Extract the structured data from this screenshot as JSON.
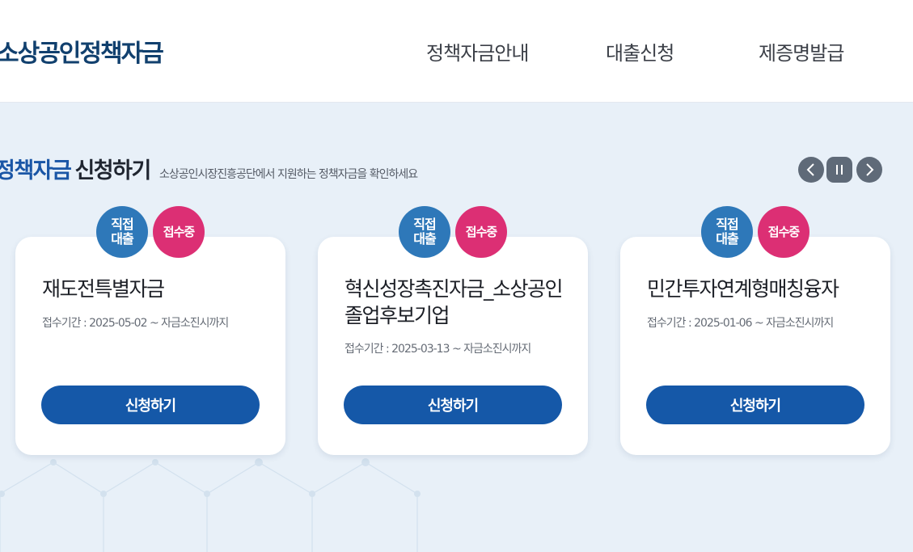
{
  "header": {
    "logo": "소상공인정책자금",
    "nav": [
      "정책자금안내",
      "대출신청",
      "제증명발급"
    ]
  },
  "section": {
    "title_accent": "정책자금",
    "title_main": "신청하기",
    "subtitle": "소상공인시장진흥공단에서 지원하는 정책자금을 확인하세요"
  },
  "slider_controls": [
    "prev-icon",
    "pause-icon",
    "next-icon"
  ],
  "cards": [
    {
      "badge_type": "직접\n대출",
      "badge_status": "접수중",
      "title": "재도전특별자금",
      "period": "접수기간 : 2025-05-02 ~ 자금소진시까지",
      "button": "신청하기"
    },
    {
      "badge_type": "직접\n대출",
      "badge_status": "접수중",
      "title": "혁신성장촉진자금_소상공인 졸업후보기업",
      "period": "접수기간 : 2025-03-13 ~ 자금소진시까지",
      "button": "신청하기"
    },
    {
      "badge_type": "직접\n대출",
      "badge_status": "접수중",
      "title": "민간투자연계형매칭융자",
      "period": "접수기간 : 2025-01-06 ~ 자금소진시까지",
      "button": "신청하기"
    }
  ],
  "colors": {
    "brand": "#11406e",
    "accent": "#1a56a6",
    "button": "#1558a8",
    "badge_blue": "#2e78b9",
    "badge_pink": "#dc2f74",
    "background": "#e8f0f8"
  }
}
